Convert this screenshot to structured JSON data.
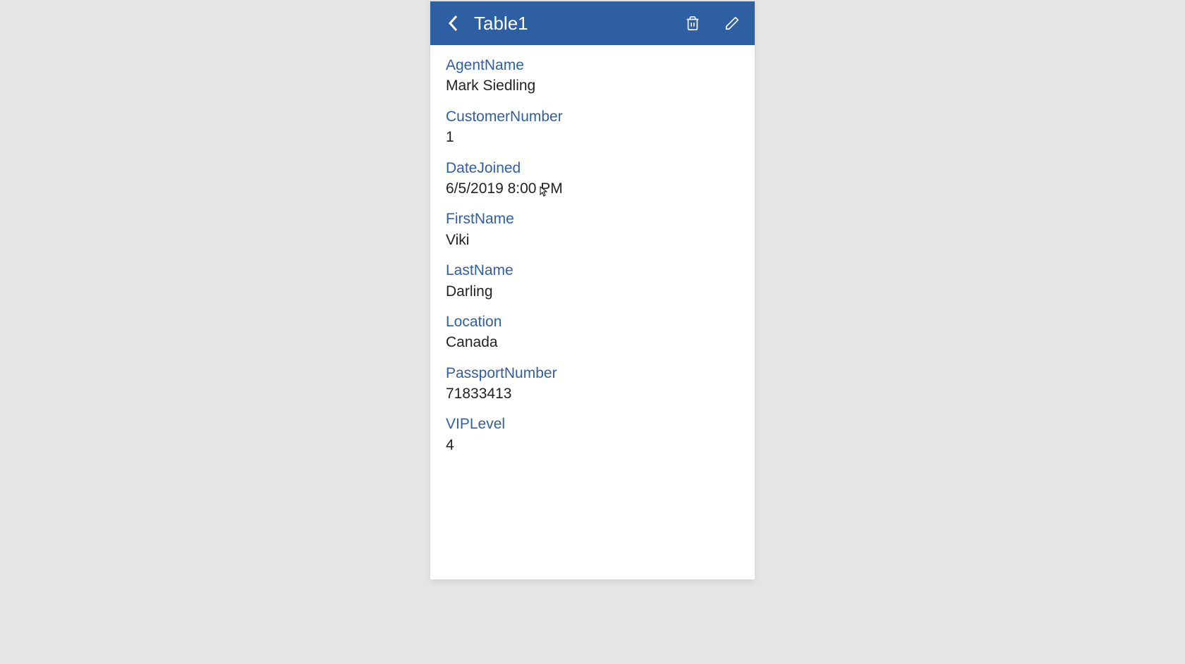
{
  "header": {
    "title": "Table1"
  },
  "fields": [
    {
      "label": "AgentName",
      "value": "Mark Siedling"
    },
    {
      "label": "CustomerNumber",
      "value": "1"
    },
    {
      "label": "DateJoined",
      "value": "6/5/2019 8:00 PM"
    },
    {
      "label": "FirstName",
      "value": "Viki"
    },
    {
      "label": "LastName",
      "value": "Darling"
    },
    {
      "label": "Location",
      "value": "Canada"
    },
    {
      "label": "PassportNumber",
      "value": "71833413"
    },
    {
      "label": "VIPLevel",
      "value": "4"
    }
  ]
}
